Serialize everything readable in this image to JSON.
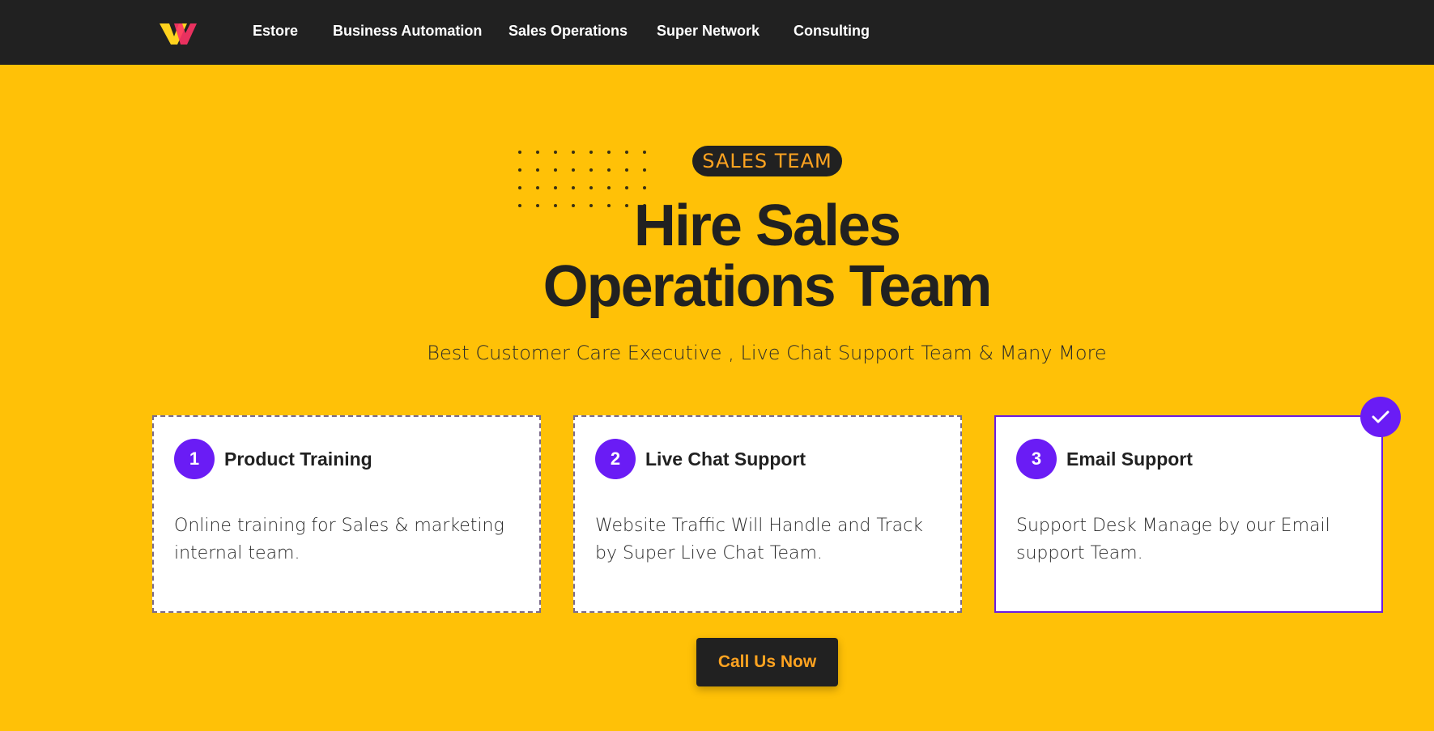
{
  "nav": {
    "logo_icon": "brand-logo-icon",
    "links": [
      "Estore",
      "Business Automation",
      "Sales Operations",
      "Super Network",
      "Consulting"
    ]
  },
  "hero": {
    "badge": "SALES TEAM",
    "title_line1": "Hire Sales",
    "title_line2": "Operations Team",
    "subtitle": "Best Customer Care Executive , Live Chat Support Team & Many More"
  },
  "cards": [
    {
      "number": "1",
      "title": "Product Training",
      "description": "Online training for Sales & marketing internal team.",
      "selected": false
    },
    {
      "number": "2",
      "title": "Live Chat Support",
      "description": "Website Traffic Will Handle and Track by Super Live Chat Team.",
      "selected": false
    },
    {
      "number": "3",
      "title": "Email Support",
      "description": "Support Desk Manage by our Email support Team.",
      "selected": true
    }
  ],
  "cta": {
    "label": "Call Us Now"
  },
  "colors": {
    "nav_bg": "#212121",
    "hero_bg": "#ffc107",
    "accent_purple": "#6a1cf5",
    "accent_orange": "#ffa320"
  }
}
